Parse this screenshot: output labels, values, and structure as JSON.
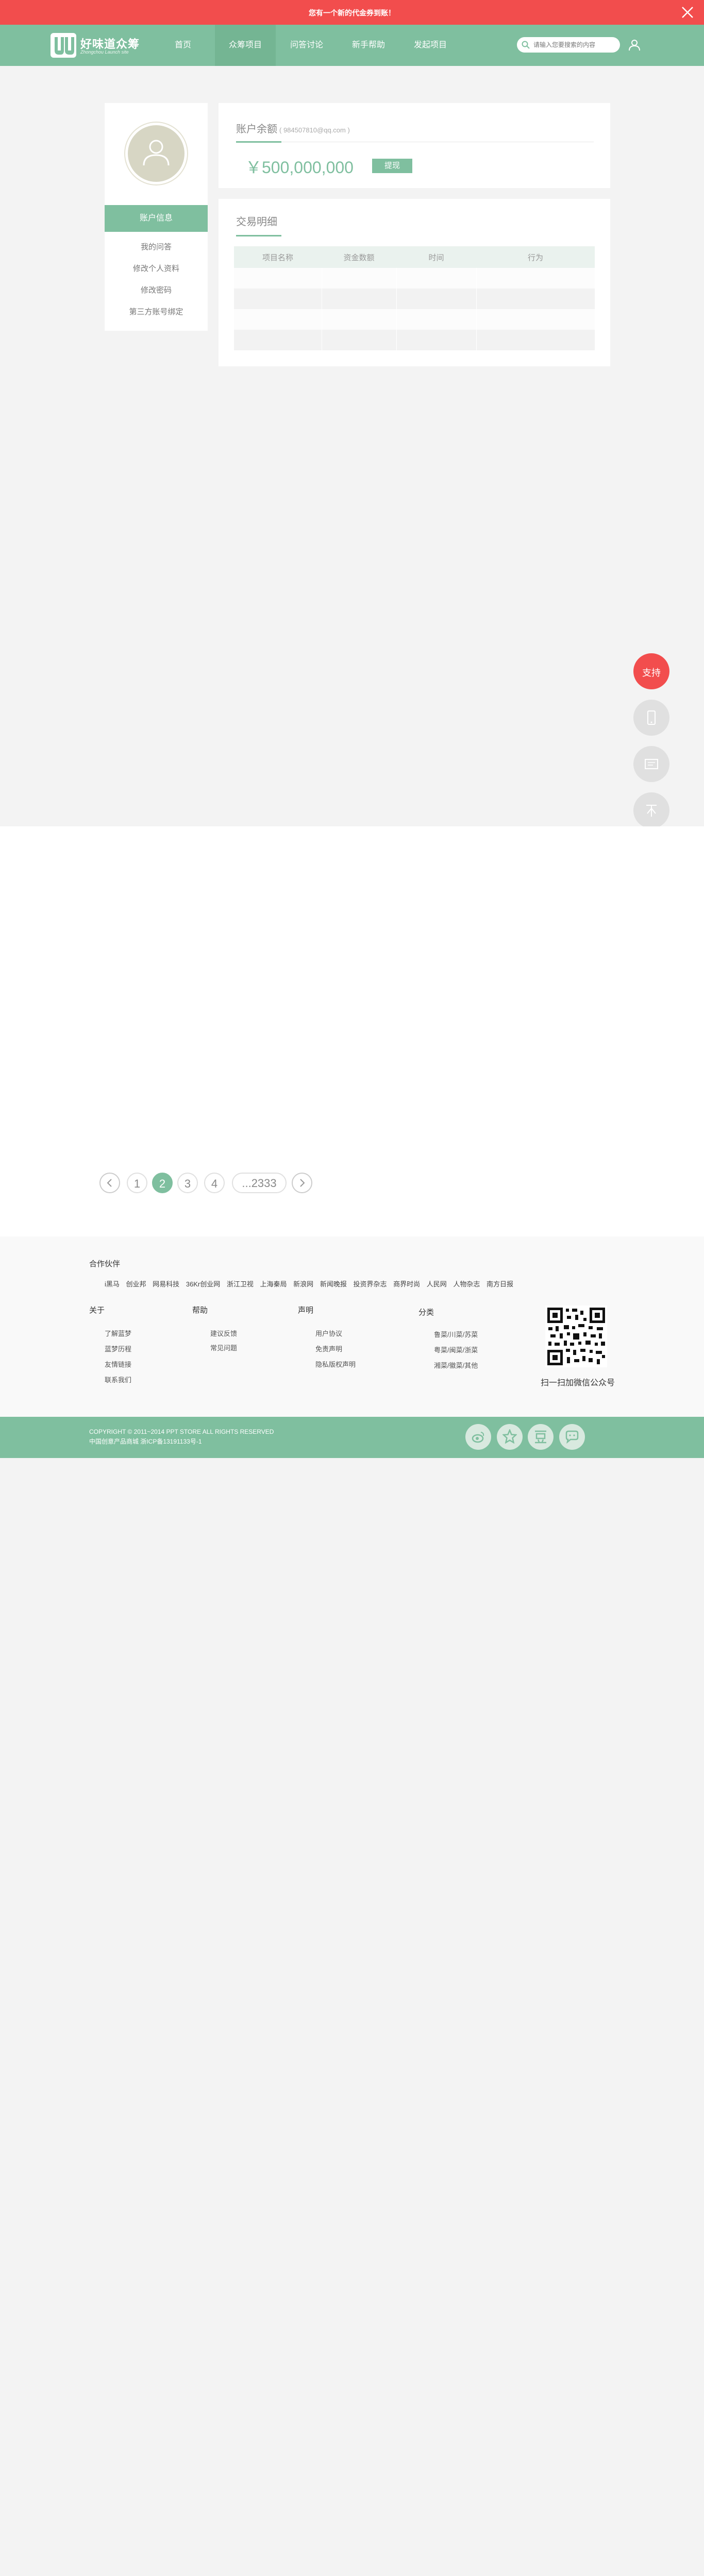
{
  "banner": {
    "text": "您有一个新的代金券到账！"
  },
  "brand": {
    "name": "好味道众筹",
    "subtitle": "Zhongchou Launch site"
  },
  "nav": {
    "items": [
      "首页",
      "众筹项目",
      "问答讨论",
      "新手帮助",
      "发起项目"
    ],
    "active_index": 1
  },
  "search": {
    "placeholder": "请输入您要搜索的内容"
  },
  "sidebar": {
    "active_item": "账户信息",
    "links": [
      "我的问答",
      "修改个人资料",
      "修改密码",
      "第三方账号绑定"
    ]
  },
  "account": {
    "title": "账户余额",
    "email": "( 984507810@qq.com )",
    "balance": "￥500,000,000",
    "withdraw_label": "提现"
  },
  "transactions": {
    "title": "交易明细",
    "columns": [
      "项目名称",
      "资金数额",
      "时间",
      "行为"
    ],
    "rows": [
      [
        "",
        "",
        "",
        ""
      ],
      [
        "",
        "",
        "",
        ""
      ],
      [
        "",
        "",
        "",
        ""
      ],
      [
        "",
        "",
        "",
        ""
      ]
    ]
  },
  "float_buttons": {
    "support_label": "支持"
  },
  "pagination": {
    "pages": [
      "1",
      "2",
      "3",
      "4"
    ],
    "current": "2",
    "more": "...2333"
  },
  "footer": {
    "partners_title": "合作伙伴",
    "partners": [
      "i黑马",
      "创业邦",
      "网易科技",
      "36Kr创业网",
      "浙江卫视",
      "上海秦局",
      "新浪网",
      "新闻晚报",
      "投资界杂志",
      "商界时尚",
      "人民网",
      "人物杂志",
      "南方日报"
    ],
    "columns": [
      {
        "title": "关于",
        "links": [
          "了解蓝梦",
          "蓝梦历程",
          "友情链接",
          "联系我们"
        ]
      },
      {
        "title": "帮助",
        "links": [
          "建议反馈",
          "常见问题"
        ]
      },
      {
        "title": "声明",
        "links": [
          "用户协议",
          "免责声明",
          "隐私版权声明"
        ]
      },
      {
        "title": "分类",
        "links": [
          "鲁菜/川菜/苏菜",
          "粤菜/闽菜/浙菜",
          "湘菜/徽菜/其他"
        ]
      }
    ],
    "qr_caption": "扫一扫加微信公众号",
    "copyright_line1": "COPYRIGHT © 2011~2014 PPT STORE ALL RIGHTS RESERVED",
    "copyright_line2": "中国创意产品商城   浙ICP备13191133号-1"
  },
  "colors": {
    "accent": "#7fbf9f",
    "alert": "#f24d4d"
  },
  "icons": [
    "close-icon",
    "logo-mark",
    "search-icon",
    "user-icon",
    "avatar-user-icon",
    "phone-icon",
    "message-icon",
    "top-arrow-icon",
    "chevron-left-icon",
    "chevron-right-icon",
    "weibo-icon",
    "star-icon",
    "douban-icon",
    "renren-icon"
  ]
}
